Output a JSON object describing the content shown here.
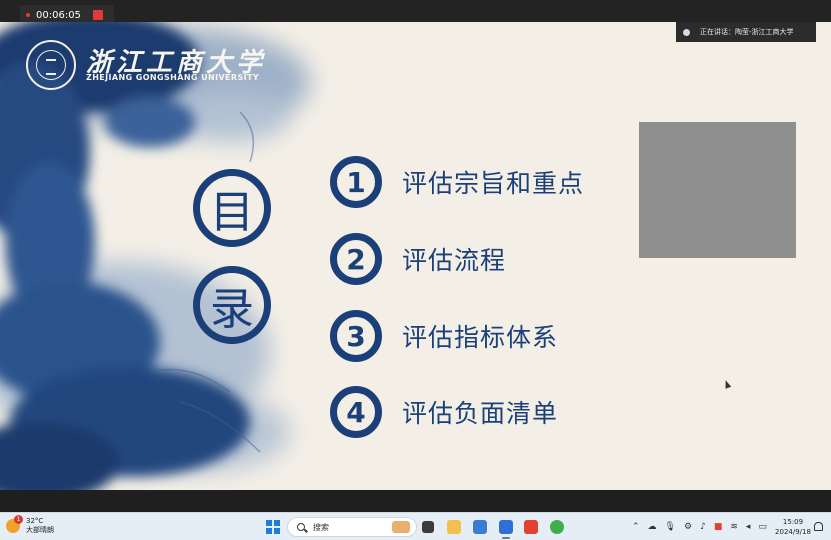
{
  "recording": {
    "timer": "00:06:05"
  },
  "slide": {
    "university_cn": "浙江工商大学",
    "university_en": "ZHEJIANG GONGSHANG UNIVERSITY",
    "contents_chars": [
      "目",
      "录"
    ],
    "menu": [
      {
        "num": "1",
        "label": "评估宗旨和重点"
      },
      {
        "num": "2",
        "label": "评估流程"
      },
      {
        "num": "3",
        "label": "评估指标体系"
      },
      {
        "num": "4",
        "label": "评估负面清单"
      }
    ]
  },
  "speaker": {
    "label": "正在讲话：陶莹-浙江工商大学"
  },
  "taskbar": {
    "weather": {
      "temp": "32°C",
      "desc": "大部晴朗",
      "badge": "1"
    },
    "search_placeholder": "搜索",
    "clock": {
      "time": "15:09",
      "date": "2024/9/18"
    }
  },
  "colors": {
    "accent": "#1b3f78",
    "slide_bg": "#f3efe6"
  }
}
